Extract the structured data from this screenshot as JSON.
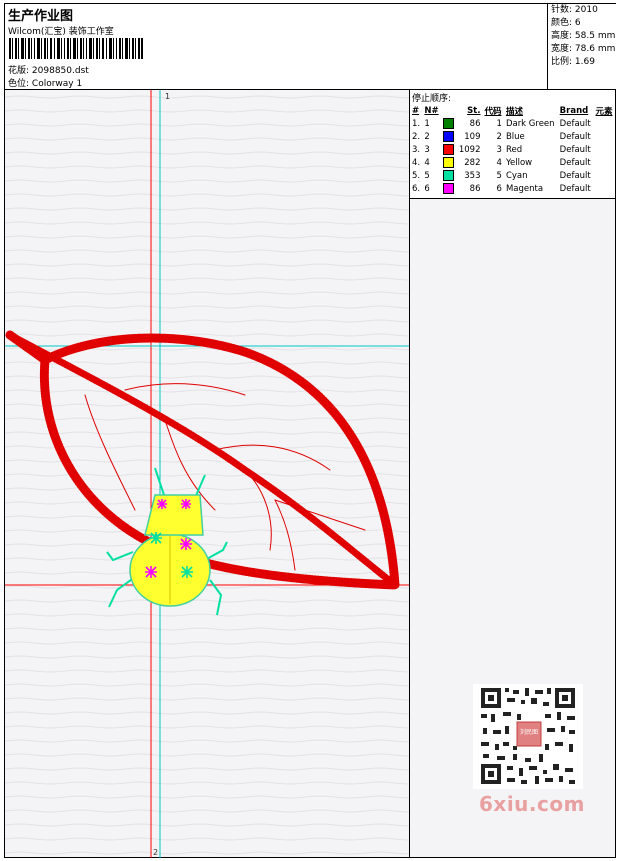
{
  "header": {
    "title": "生产作业图",
    "company": "Wilcom(汇宝) 装饰工作室",
    "design_label": "花版:",
    "design_value": "2098850.dst",
    "colorway_label": "色位:",
    "colorway_value": "Colorway 1"
  },
  "specs": [
    {
      "label": "针数:",
      "value": "2010"
    },
    {
      "label": "颜色:",
      "value": "6"
    },
    {
      "label": "高度:",
      "value": "58.5 mm"
    },
    {
      "label": "宽度:",
      "value": "78.6 mm"
    },
    {
      "label": "比例:",
      "value": "1.69"
    }
  ],
  "legend": {
    "title": "停止顺序:",
    "columns": [
      "#",
      "N#",
      "St.",
      "代码",
      "描述",
      "Brand",
      "元素"
    ],
    "rows": [
      {
        "num": "1.",
        "n": "1",
        "color": "#008000",
        "st": "86",
        "code": "1",
        "desc": "Dark Green",
        "brand": "Default"
      },
      {
        "num": "2.",
        "n": "2",
        "color": "#0000ff",
        "st": "109",
        "code": "2",
        "desc": "Blue",
        "brand": "Default"
      },
      {
        "num": "3.",
        "n": "3",
        "color": "#ff0000",
        "st": "1092",
        "code": "3",
        "desc": "Red",
        "brand": "Default"
      },
      {
        "num": "4.",
        "n": "4",
        "color": "#ffff00",
        "st": "282",
        "code": "4",
        "desc": "Yellow",
        "brand": "Default"
      },
      {
        "num": "5.",
        "n": "5",
        "color": "#00e0a0",
        "st": "353",
        "code": "5",
        "desc": "Cyan",
        "brand": "Default"
      },
      {
        "num": "6.",
        "n": "6",
        "color": "#ff00ff",
        "st": "86",
        "code": "6",
        "desc": "Magenta",
        "brand": "Default"
      }
    ]
  },
  "canvas": {
    "axis_top_label": "1",
    "axis_bottom_label": "2"
  },
  "watermark": "6xiu.com",
  "qr_stamp": "刘民图"
}
